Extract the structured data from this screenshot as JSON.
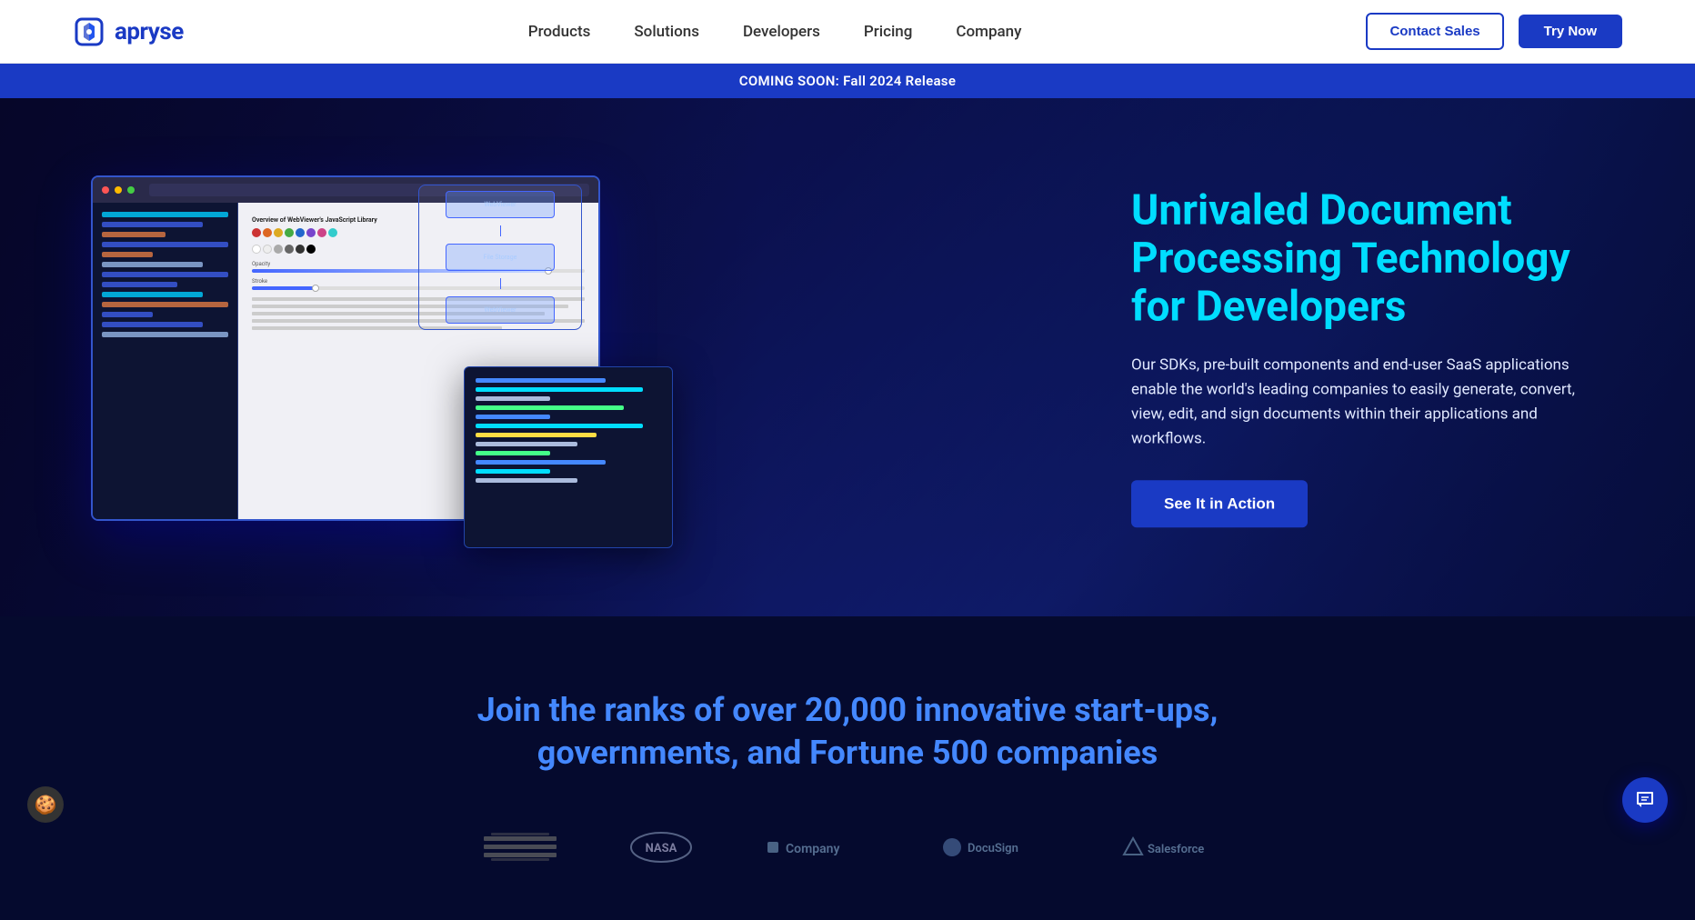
{
  "brand": {
    "name": "apryse",
    "logo_alt": "Apryse logo"
  },
  "navbar": {
    "products_label": "Products",
    "solutions_label": "Solutions",
    "developers_label": "Developers",
    "pricing_label": "Pricing",
    "company_label": "Company",
    "contact_sales_label": "Contact Sales",
    "try_now_label": "Try Now"
  },
  "announcement": {
    "text": "COMING SOON: Fall 2024 Release"
  },
  "hero": {
    "title": "Unrivaled Document Processing Technology for Developers",
    "description": "Our SDKs, pre-built components and end-user SaaS applications enable the world's leading companies to easily generate, convert, view, edit, and sign documents within their applications and workflows.",
    "cta_label": "See It in Action"
  },
  "social_proof": {
    "title_line1": "Join the ranks of over 20,000 innovative start-ups,",
    "title_line2": "governments, and Fortune 500 companies"
  },
  "chat": {
    "icon": "💬"
  },
  "cookie": {
    "icon": "🍪"
  },
  "colors": {
    "brand_blue": "#1a3ac4",
    "hero_cyan": "#00ddff",
    "dark_bg": "#050a2e"
  }
}
